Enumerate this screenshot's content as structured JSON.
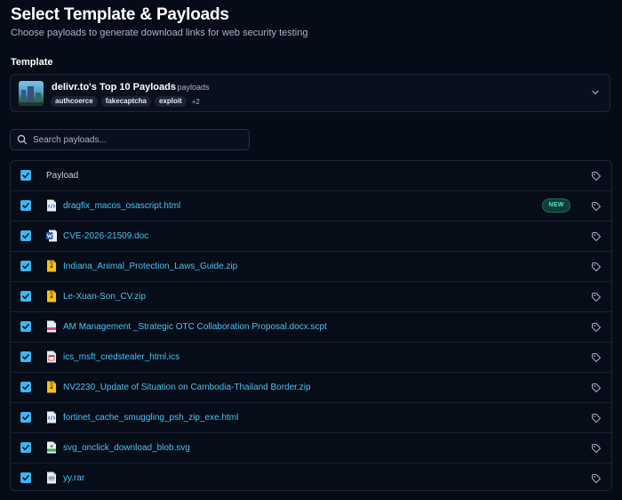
{
  "page": {
    "title": "Select Template & Payloads",
    "subtitle": "Choose payloads to generate download links for web security testing"
  },
  "template_section": {
    "label": "Template",
    "selected": {
      "name": "delivr.to's Top 10 Payloads",
      "count": "10 payloads",
      "tags": [
        "authcoerce",
        "fakecaptcha",
        "exploit"
      ],
      "more_tags": "+2"
    }
  },
  "search": {
    "placeholder": "Search payloads..."
  },
  "table": {
    "header": "Payload",
    "rows": [
      {
        "name": "dragfix_macos_osascript.html",
        "icon": "html-file-icon",
        "checked": true,
        "badge": "NEW"
      },
      {
        "name": "CVE-2026-21509.doc",
        "icon": "word-file-icon",
        "checked": true
      },
      {
        "name": "Indiana_Animal_Protection_Laws_Guide.zip",
        "icon": "zip-file-icon",
        "checked": true
      },
      {
        "name": "Le-Xuan-Son_CV.zip",
        "icon": "zip-file-icon",
        "checked": true
      },
      {
        "name": "AM Management _Strategic OTC Collaboration Proposal.docx.scpt",
        "icon": "script-file-icon",
        "checked": true
      },
      {
        "name": "ics_msft_credstealer_html.ics",
        "icon": "calendar-file-icon",
        "checked": true
      },
      {
        "name": "NV2230_Update of Situation on Cambodia-Thailand Border.zip",
        "icon": "zip-file-icon",
        "checked": true
      },
      {
        "name": "fortinet_cache_smuggling_psh_zip_exe.html",
        "icon": "html-file-icon",
        "checked": true
      },
      {
        "name": "svg_onclick_download_blob.svg",
        "icon": "svg-file-icon",
        "checked": true
      },
      {
        "name": "yy.rar",
        "icon": "rar-file-icon",
        "checked": true
      }
    ]
  },
  "colors": {
    "background": "#060b18",
    "accent": "#3fb6ee",
    "link": "#4cc3ef",
    "new_badge": "#5de3c4"
  }
}
